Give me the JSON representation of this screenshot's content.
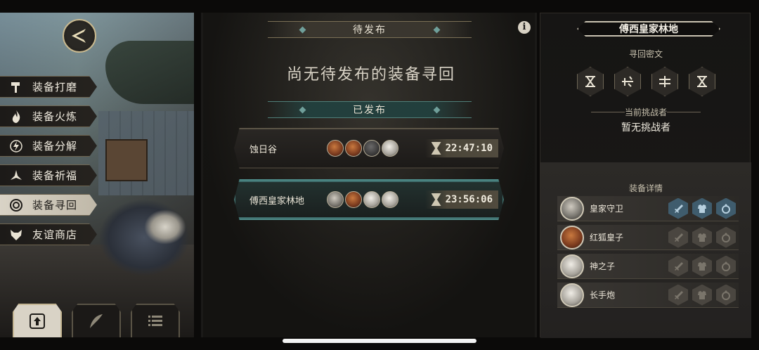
{
  "menu": {
    "items": [
      {
        "label": "装备打磨",
        "icon": "hammer-icon",
        "active": false
      },
      {
        "label": "装备火炼",
        "icon": "flame-icon",
        "active": false
      },
      {
        "label": "装备分解",
        "icon": "lightning-icon",
        "active": false
      },
      {
        "label": "装备祈福",
        "icon": "pray-icon",
        "active": false
      },
      {
        "label": "装备寻回",
        "icon": "spiral-icon",
        "active": true
      },
      {
        "label": "友谊商店",
        "icon": "fox-icon",
        "active": false
      }
    ]
  },
  "bottom_tabs": [
    {
      "icon": "publish-icon",
      "active": true
    },
    {
      "icon": "quill-icon",
      "active": false
    },
    {
      "icon": "list-icon",
      "active": false
    }
  ],
  "pending": {
    "header": "待发布",
    "empty_message": "尚无待发布的装备寻回"
  },
  "released": {
    "header": "已发布",
    "quests": [
      {
        "name": "蚀日谷",
        "timer": "22:47:10",
        "avatars": [
          "red",
          "red",
          "dark",
          "white"
        ],
        "selected": false
      },
      {
        "name": "傅西皇家林地",
        "timer": "23:56:06",
        "avatars": [
          "grey",
          "red",
          "white",
          "white"
        ],
        "selected": true
      }
    ]
  },
  "detail": {
    "place": "傅西皇家林地",
    "cipher_label": "寻回密文",
    "challenger_label": "当前挑战者",
    "challenger_value": "暂无挑战者",
    "equipment_label": "装备详情",
    "rows": [
      {
        "name": "皇家守卫",
        "portrait": "grey",
        "slots_active": [
          true,
          true,
          true
        ]
      },
      {
        "name": "红狐皇子",
        "portrait": "red",
        "slots_active": [
          false,
          false,
          false
        ]
      },
      {
        "name": "神之子",
        "portrait": "white",
        "slots_active": [
          false,
          false,
          false
        ]
      },
      {
        "name": "长手炮",
        "portrait": "white",
        "slots_active": [
          false,
          false,
          false
        ]
      }
    ]
  },
  "colors": {
    "accent_teal": "#4e8c8a",
    "gold_border": "#c9b98f",
    "active_menu": "#d9d3c6"
  }
}
